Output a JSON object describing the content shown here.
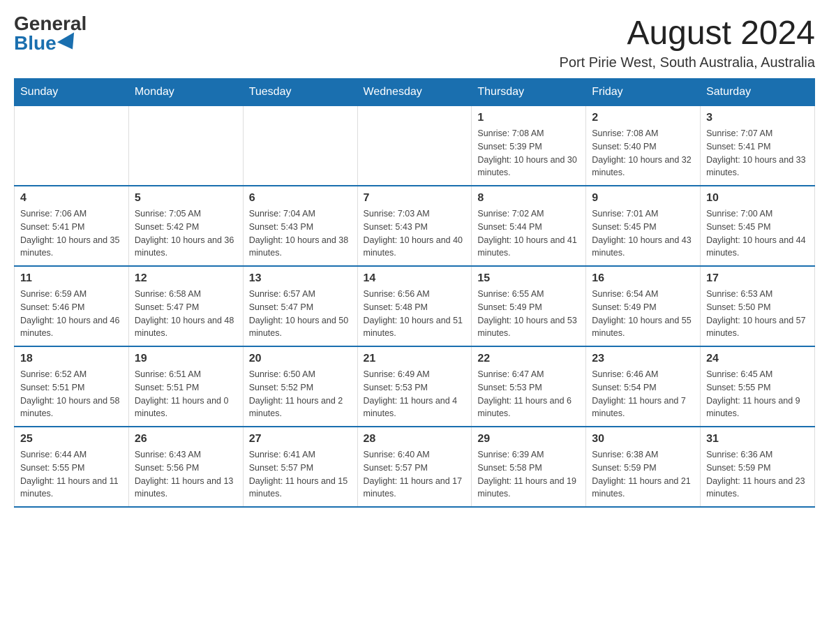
{
  "logo": {
    "general": "General",
    "blue": "Blue"
  },
  "title": "August 2024",
  "location": "Port Pirie West, South Australia, Australia",
  "header": {
    "days": [
      "Sunday",
      "Monday",
      "Tuesday",
      "Wednesday",
      "Thursday",
      "Friday",
      "Saturday"
    ]
  },
  "weeks": [
    [
      {
        "day": "",
        "info": ""
      },
      {
        "day": "",
        "info": ""
      },
      {
        "day": "",
        "info": ""
      },
      {
        "day": "",
        "info": ""
      },
      {
        "day": "1",
        "info": "Sunrise: 7:08 AM\nSunset: 5:39 PM\nDaylight: 10 hours and 30 minutes."
      },
      {
        "day": "2",
        "info": "Sunrise: 7:08 AM\nSunset: 5:40 PM\nDaylight: 10 hours and 32 minutes."
      },
      {
        "day": "3",
        "info": "Sunrise: 7:07 AM\nSunset: 5:41 PM\nDaylight: 10 hours and 33 minutes."
      }
    ],
    [
      {
        "day": "4",
        "info": "Sunrise: 7:06 AM\nSunset: 5:41 PM\nDaylight: 10 hours and 35 minutes."
      },
      {
        "day": "5",
        "info": "Sunrise: 7:05 AM\nSunset: 5:42 PM\nDaylight: 10 hours and 36 minutes."
      },
      {
        "day": "6",
        "info": "Sunrise: 7:04 AM\nSunset: 5:43 PM\nDaylight: 10 hours and 38 minutes."
      },
      {
        "day": "7",
        "info": "Sunrise: 7:03 AM\nSunset: 5:43 PM\nDaylight: 10 hours and 40 minutes."
      },
      {
        "day": "8",
        "info": "Sunrise: 7:02 AM\nSunset: 5:44 PM\nDaylight: 10 hours and 41 minutes."
      },
      {
        "day": "9",
        "info": "Sunrise: 7:01 AM\nSunset: 5:45 PM\nDaylight: 10 hours and 43 minutes."
      },
      {
        "day": "10",
        "info": "Sunrise: 7:00 AM\nSunset: 5:45 PM\nDaylight: 10 hours and 44 minutes."
      }
    ],
    [
      {
        "day": "11",
        "info": "Sunrise: 6:59 AM\nSunset: 5:46 PM\nDaylight: 10 hours and 46 minutes."
      },
      {
        "day": "12",
        "info": "Sunrise: 6:58 AM\nSunset: 5:47 PM\nDaylight: 10 hours and 48 minutes."
      },
      {
        "day": "13",
        "info": "Sunrise: 6:57 AM\nSunset: 5:47 PM\nDaylight: 10 hours and 50 minutes."
      },
      {
        "day": "14",
        "info": "Sunrise: 6:56 AM\nSunset: 5:48 PM\nDaylight: 10 hours and 51 minutes."
      },
      {
        "day": "15",
        "info": "Sunrise: 6:55 AM\nSunset: 5:49 PM\nDaylight: 10 hours and 53 minutes."
      },
      {
        "day": "16",
        "info": "Sunrise: 6:54 AM\nSunset: 5:49 PM\nDaylight: 10 hours and 55 minutes."
      },
      {
        "day": "17",
        "info": "Sunrise: 6:53 AM\nSunset: 5:50 PM\nDaylight: 10 hours and 57 minutes."
      }
    ],
    [
      {
        "day": "18",
        "info": "Sunrise: 6:52 AM\nSunset: 5:51 PM\nDaylight: 10 hours and 58 minutes."
      },
      {
        "day": "19",
        "info": "Sunrise: 6:51 AM\nSunset: 5:51 PM\nDaylight: 11 hours and 0 minutes."
      },
      {
        "day": "20",
        "info": "Sunrise: 6:50 AM\nSunset: 5:52 PM\nDaylight: 11 hours and 2 minutes."
      },
      {
        "day": "21",
        "info": "Sunrise: 6:49 AM\nSunset: 5:53 PM\nDaylight: 11 hours and 4 minutes."
      },
      {
        "day": "22",
        "info": "Sunrise: 6:47 AM\nSunset: 5:53 PM\nDaylight: 11 hours and 6 minutes."
      },
      {
        "day": "23",
        "info": "Sunrise: 6:46 AM\nSunset: 5:54 PM\nDaylight: 11 hours and 7 minutes."
      },
      {
        "day": "24",
        "info": "Sunrise: 6:45 AM\nSunset: 5:55 PM\nDaylight: 11 hours and 9 minutes."
      }
    ],
    [
      {
        "day": "25",
        "info": "Sunrise: 6:44 AM\nSunset: 5:55 PM\nDaylight: 11 hours and 11 minutes."
      },
      {
        "day": "26",
        "info": "Sunrise: 6:43 AM\nSunset: 5:56 PM\nDaylight: 11 hours and 13 minutes."
      },
      {
        "day": "27",
        "info": "Sunrise: 6:41 AM\nSunset: 5:57 PM\nDaylight: 11 hours and 15 minutes."
      },
      {
        "day": "28",
        "info": "Sunrise: 6:40 AM\nSunset: 5:57 PM\nDaylight: 11 hours and 17 minutes."
      },
      {
        "day": "29",
        "info": "Sunrise: 6:39 AM\nSunset: 5:58 PM\nDaylight: 11 hours and 19 minutes."
      },
      {
        "day": "30",
        "info": "Sunrise: 6:38 AM\nSunset: 5:59 PM\nDaylight: 11 hours and 21 minutes."
      },
      {
        "day": "31",
        "info": "Sunrise: 6:36 AM\nSunset: 5:59 PM\nDaylight: 11 hours and 23 minutes."
      }
    ]
  ]
}
